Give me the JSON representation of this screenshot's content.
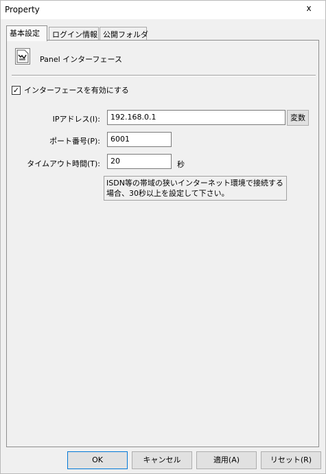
{
  "window": {
    "title": "Property",
    "close_glyph": "x"
  },
  "tabs": [
    {
      "label": "基本設定",
      "active": true
    },
    {
      "label": "ログイン情報",
      "active": false
    },
    {
      "label": "公開フォルダ",
      "active": false
    }
  ],
  "panel": {
    "header_title": "Panel インターフェース",
    "enable_checkbox": {
      "label": "インターフェースを有効にする",
      "checked": true,
      "mark": "✓"
    },
    "ip": {
      "label": "IPアドレス(I):",
      "value": "192.168.0.1",
      "var_button": "変数"
    },
    "port": {
      "label": "ポート番号(P):",
      "value": "6001"
    },
    "timeout": {
      "label": "タイムアウト時間(T):",
      "value": "20",
      "unit": "秒"
    },
    "note": "ISDN等の帯域の狭いインターネット環境で接続する場合、30秒以上を設定して下さい。"
  },
  "buttons": {
    "ok": "OK",
    "cancel": "キャンセル",
    "apply": "適用(A)",
    "reset": "リセット(R)"
  }
}
